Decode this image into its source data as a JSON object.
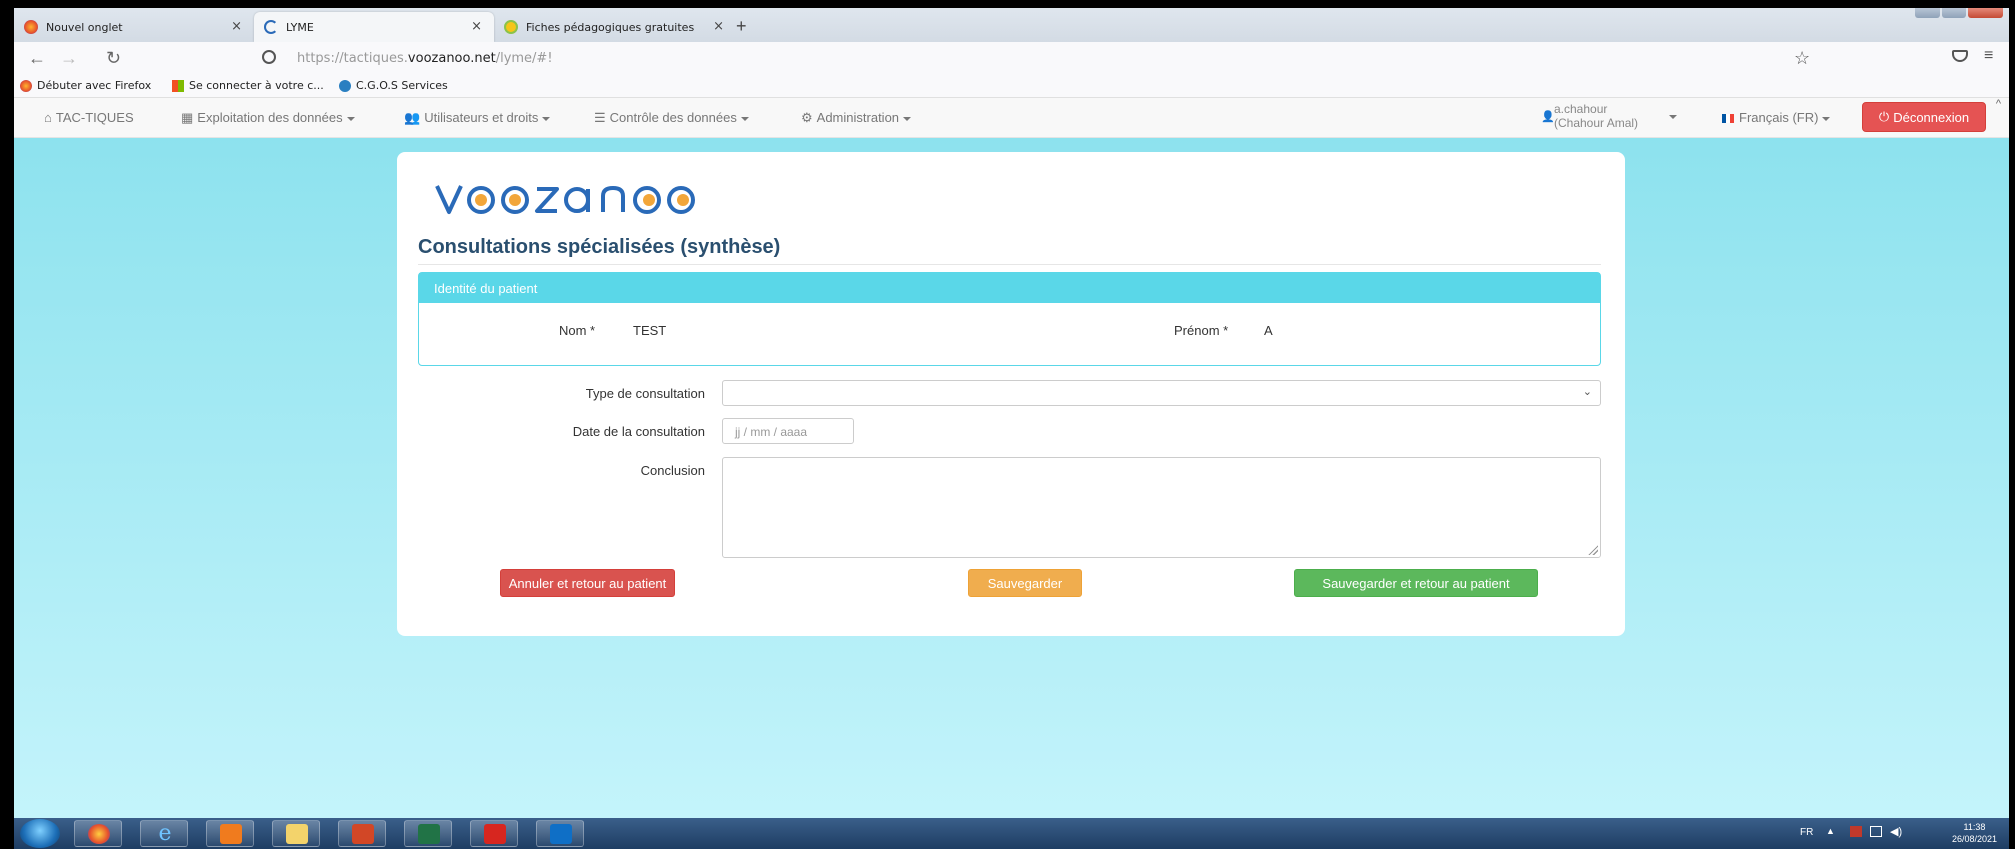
{
  "browser": {
    "tabs": [
      {
        "label": "Nouvel onglet",
        "icon": "firefox-icon"
      },
      {
        "label": "LYME",
        "icon": "loading-icon"
      },
      {
        "label": "Fiches pédagogiques gratuites",
        "icon": "site-icon"
      }
    ],
    "new_tab": "+",
    "close": "×",
    "url_prefix": "https://tactiques.",
    "url_domain": "voozanoo.net",
    "url_suffix": "/lyme/#!",
    "bookmarks": [
      {
        "label": "Débuter avec Firefox"
      },
      {
        "label": "Se connecter à votre c..."
      },
      {
        "label": "C.G.O.S Services"
      }
    ]
  },
  "appnav": {
    "home": "TAC-TIQUES",
    "items": [
      "Exploitation des données",
      "Utilisateurs et droits",
      "Contrôle des données",
      "Administration"
    ],
    "user_line1": "a.chahour",
    "user_line2": "(Chahour Amal)",
    "language": "Français (FR)",
    "logout": "Déconnexion"
  },
  "page": {
    "logo": "voozanoo",
    "title": "Consultations spécialisées (synthèse)",
    "panel_title": "Identité du patient",
    "nom_label": "Nom *",
    "nom_value": "TEST",
    "prenom_label": "Prénom *",
    "prenom_value": "A",
    "type_label": "Type de consultation",
    "type_value": "",
    "date_label": "Date de la consultation",
    "date_placeholder": "jj / mm / aaaa",
    "conclusion_label": "Conclusion",
    "conclusion_value": "",
    "btn_cancel": "Annuler et retour au patient",
    "btn_save": "Sauvegarder",
    "btn_save_return": "Sauvegarder et retour au patient"
  },
  "taskbar": {
    "lang": "FR",
    "time": "11:38",
    "date": "26/08/2021"
  },
  "colors": {
    "accent": "#5ad7e8",
    "title": "#2a4f6f",
    "danger": "#d9534f",
    "warning": "#f0ad4e",
    "success": "#5cb85c"
  }
}
